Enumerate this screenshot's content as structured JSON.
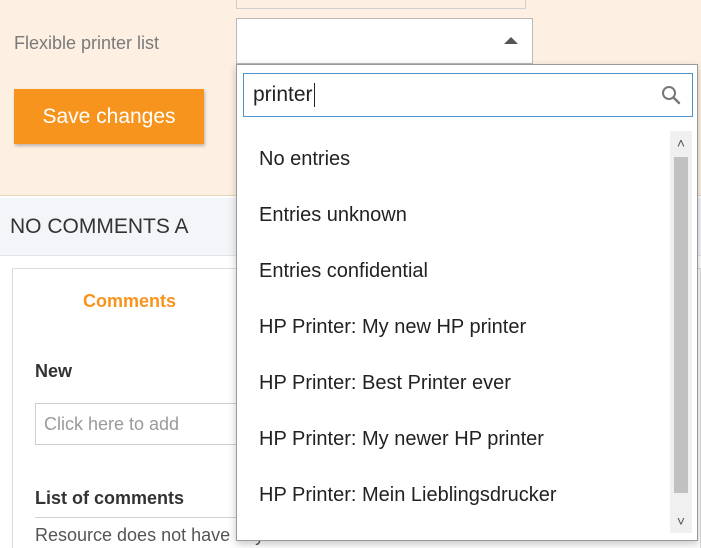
{
  "form": {
    "label": "Flexible printer list",
    "save_label": "Save changes"
  },
  "comments": {
    "header": "NO COMMENTS A",
    "tab": "Comments",
    "new_label": "New",
    "input_placeholder": "Click here to add",
    "list_label": "List of comments",
    "no_comments": "Resource does not have any comments"
  },
  "dropdown": {
    "search_value": "printer",
    "options": [
      "No entries",
      "Entries unknown",
      "Entries confidential",
      "HP Printer: My new HP printer",
      "HP Printer: Best Printer ever",
      "HP Printer: My newer HP printer",
      "HP Printer: Mein Lieblingsdrucker"
    ]
  },
  "colors": {
    "accent": "#f7941d",
    "form_bg": "#fdf0e3",
    "focus_border": "#4f93ce"
  },
  "icons": {
    "search": "search-icon",
    "select_open": "triangle-up-icon",
    "scroll_up": "chevron-up-icon",
    "scroll_down": "chevron-down-icon"
  }
}
